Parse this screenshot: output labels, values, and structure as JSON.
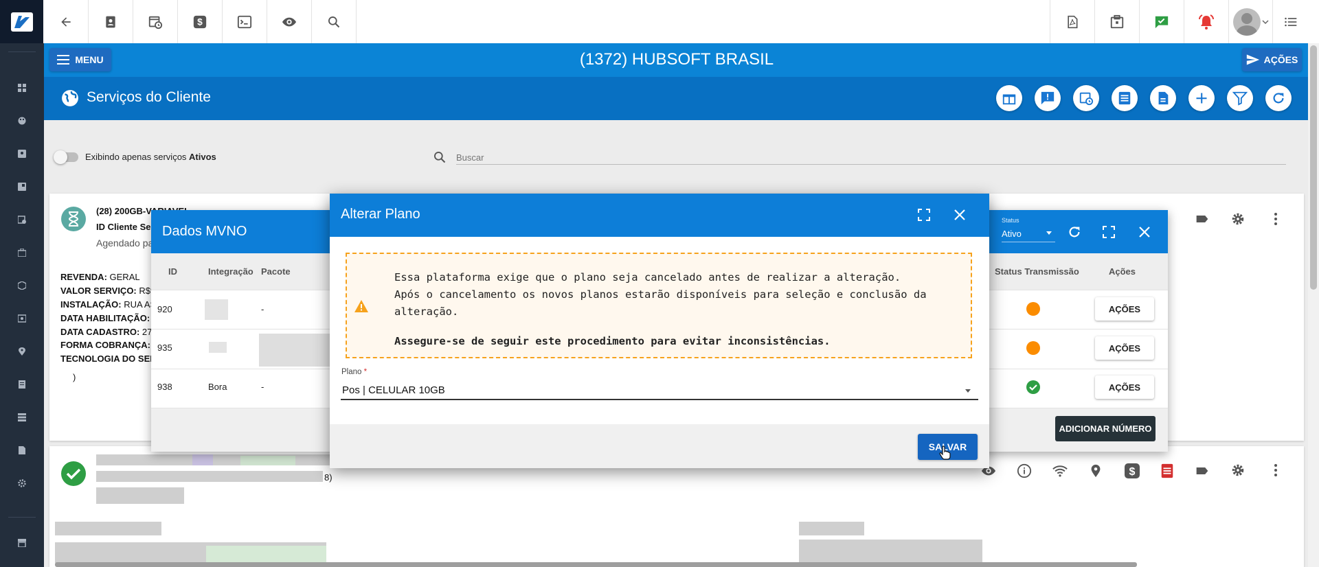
{
  "topbar": {
    "left_icons": [
      "back-arrow-icon",
      "contact-card-icon",
      "schedule-icon",
      "dollar-icon",
      "terminal-icon",
      "eye-icon",
      "search-icon"
    ],
    "right_icons": [
      "pdf-file-icon",
      "calendar-icon",
      "chat-check-icon",
      "alarm-bell-icon",
      "avatar",
      "list-icon"
    ]
  },
  "sidebar": {
    "icons": [
      "dashboard-icon",
      "palette-icon",
      "contact-icon",
      "book-icon",
      "clock-icon",
      "briefcase-icon",
      "box-icon",
      "money-icon",
      "location-icon",
      "document-icon",
      "server-icon",
      "file-icon",
      "settings-icon",
      "store-icon"
    ]
  },
  "header": {
    "menu_label": "MENU",
    "client_title": "(1372) HUBSOFT BRASIL",
    "acoes_label": "AÇÕES",
    "page_title": "Serviços do Cliente",
    "action_icons": [
      "gift-icon",
      "alert-message-icon",
      "schedule-icon",
      "list-icon",
      "file-icon",
      "add-icon",
      "filter-icon",
      "refresh-icon"
    ]
  },
  "filter": {
    "toggle_label_prefix": "Exibindo apenas serviços ",
    "toggle_label_bold": "Ativos",
    "search_placeholder": "Buscar"
  },
  "card1": {
    "service_name": "(28) 200GB-VARIAVEL",
    "id_line": "ID Cliente Se",
    "schedule_line": "Agendado pa",
    "details": [
      {
        "label": "REVENDA:",
        "value": " GERAL"
      },
      {
        "label": "VALOR SERVIÇO:",
        "value": " R$9"
      },
      {
        "label": "INSTALAÇÃO:",
        "value": " RUA AS"
      },
      {
        "label": "DATA HABILITAÇÃO:",
        "value": ""
      },
      {
        "label": "DATA CADASTRO:",
        "value": " 27"
      },
      {
        "label": "FORMA COBRANÇA:",
        "value": ""
      },
      {
        "label": "TECNOLOGIA DO SER",
        "value": ""
      }
    ],
    "paren": ")"
  },
  "card2": {
    "fragment": "8)"
  },
  "mvno": {
    "title": "Dados MVNO",
    "status_label": "Status",
    "status_value": "Ativo",
    "columns": {
      "id": "ID",
      "integracao": "Integração",
      "pacote": "Pacote",
      "status_transmissao": "Status Transmissão",
      "acoes": "Ações"
    },
    "rows": [
      {
        "id": "920",
        "integracao": "",
        "pacote": "-",
        "status": "pending",
        "acoes": "AÇÕES"
      },
      {
        "id": "935",
        "integracao": "",
        "pacote": "",
        "status": "pending",
        "acoes": "AÇÕES"
      },
      {
        "id": "938",
        "integracao": "Bora",
        "pacote": "-",
        "status": "ok",
        "acoes": "AÇÕES"
      }
    ],
    "add_button": "ADICIONAR NÚMERO"
  },
  "plano_dialog": {
    "title": "Alterar Plano",
    "warning_lines": [
      "Essa plataforma exige que o plano seja cancelado antes de realizar a alteração.",
      "Após o cancelamento os novos planos estarão disponíveis para seleção e conclusão da",
      "alteração."
    ],
    "warning_strong": "Assegure-se de seguir este procedimento para evitar inconsistências.",
    "field_label": "Plano",
    "field_required_mark": "*",
    "field_value": "Pos | CELULAR 10GB",
    "save_label": "SALVAR"
  },
  "colors": {
    "header_blue": "#0b84d6",
    "header_blue_dark": "#0870c2",
    "dialog_blue": "#0d7ed8",
    "sidebar": "#232e3c",
    "warning_orange": "#f6a21c",
    "status_orange": "#fb8c00",
    "status_green": "#2e9e44",
    "save_button": "#1565c0"
  }
}
